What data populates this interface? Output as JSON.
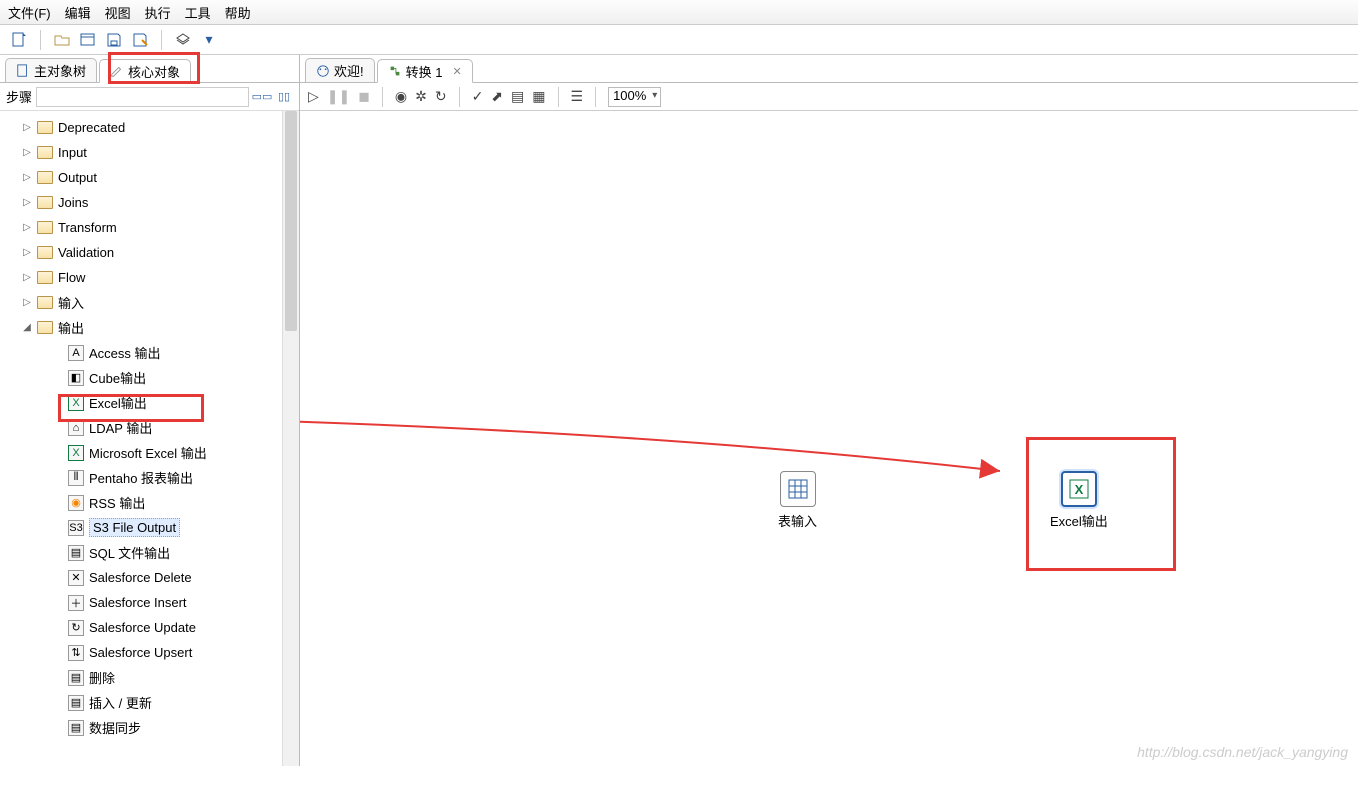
{
  "menu": {
    "file": "文件(F)",
    "edit": "编辑",
    "view": "视图",
    "run": "执行",
    "tools": "工具",
    "help": "帮助"
  },
  "tabs_left": {
    "main_tree": "主对象树",
    "core_obj": "核心对象"
  },
  "steps_label": "步骤",
  "tree": {
    "deprecated": "Deprecated",
    "input": "Input",
    "output": "Output",
    "joins": "Joins",
    "transform": "Transform",
    "validation": "Validation",
    "flow": "Flow",
    "input_cn": "输入",
    "output_cn": "输出",
    "children": [
      "Access 输出",
      "Cube输出",
      "Excel输出",
      "LDAP 输出",
      "Microsoft Excel 输出",
      "Pentaho 报表输出",
      "RSS 输出",
      "S3 File Output",
      "SQL 文件输出",
      "Salesforce Delete",
      "Salesforce Insert",
      "Salesforce Update",
      "Salesforce Upsert",
      "删除",
      "插入 / 更新",
      "数据同步"
    ]
  },
  "tabs_right": {
    "welcome": "欢迎!",
    "trans": "转换 1"
  },
  "zoom": "100%",
  "canvas": {
    "step1": "表输入",
    "step2": "Excel输出"
  },
  "watermark": "http://blog.csdn.net/jack_yangying"
}
